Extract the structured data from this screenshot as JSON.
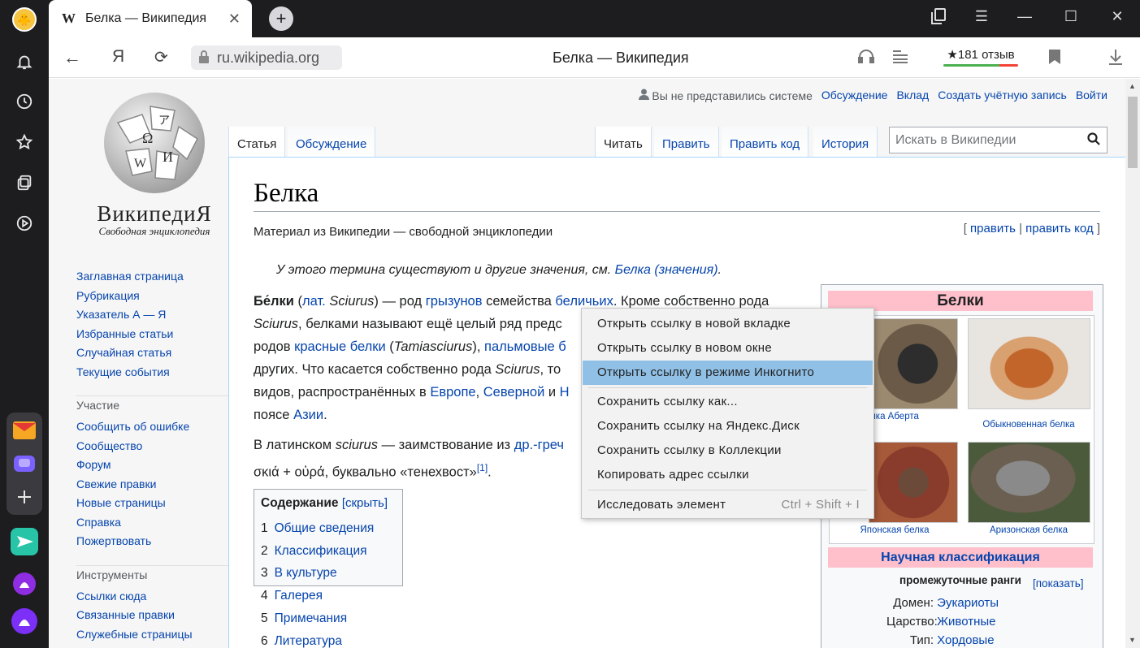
{
  "browser": {
    "tab_title": "Белка — Википедия",
    "tab_icon": "W",
    "url": "ru.wikipedia.org",
    "page_title": "Белка — Википедия",
    "reviews_label": "★181 отзыв"
  },
  "personal": {
    "not_logged": "Вы не представились системе",
    "talk": "Обсуждение",
    "contributions": "Вклад",
    "create_account": "Создать учётную запись",
    "login": "Войти"
  },
  "logo": {
    "name": "ВикипедиЯ",
    "subtitle": "Свободная энциклопедия"
  },
  "tabs": {
    "article": "Статья",
    "talk": "Обсуждение",
    "read": "Читать",
    "edit": "Править",
    "edit_source": "Править код",
    "history": "История"
  },
  "search": {
    "placeholder": "Искать в Википедии"
  },
  "sidebar": {
    "main": [
      "Заглавная страница",
      "Рубрикация",
      "Указатель А — Я",
      "Избранные статьи",
      "Случайная статья",
      "Текущие события"
    ],
    "participation_title": "Участие",
    "participation": [
      "Сообщить об ошибке",
      "Сообщество",
      "Форум",
      "Свежие правки",
      "Новые страницы",
      "Справка",
      "Пожертвовать"
    ],
    "tools_title": "Инструменты",
    "tools": [
      "Ссылки сюда",
      "Связанные правки",
      "Служебные страницы"
    ]
  },
  "article": {
    "title": "Белка",
    "tagline": "Материал из Википедии — свободной энциклопедии",
    "edit_open": "[",
    "edit": "править",
    "edit_sep": "|",
    "edit_source": "править код",
    "edit_close": "]",
    "hatnote_prefix": "У этого термина существуют и другие значения, см. ",
    "hatnote_link": "Белка (значения)",
    "hatnote_suffix": ".",
    "p1_l1_a": "Бе́лки",
    "p1_l1_b": " (",
    "p1_l1_c": "лат.",
    "p1_l1_d": " Sciurus",
    "p1_l1_e": ") — род ",
    "p1_l1_f": "грызунов",
    "p1_l1_g": " семейства ",
    "p1_l1_h": "беличьих",
    "p1_l1_i": ". Кроме собственно рода",
    "p1_l2_a": "Sciurus",
    "p1_l2_b": ", белками называют ещё целый ряд предс",
    "p1_l3_a": "родов ",
    "p1_l3_b": "красные белки",
    "p1_l3_c": " (",
    "p1_l3_d": "Tamiasciurus",
    "p1_l3_e": "), ",
    "p1_l3_f": "пальмовые б",
    "p1_l4_a": "других. Что касается собственно рода ",
    "p1_l4_b": "Sciurus",
    "p1_l4_c": ", то",
    "p1_l5_a": "видов, распространённых в ",
    "p1_l5_b": "Европе",
    "p1_l5_c": ", ",
    "p1_l5_d": "Северной",
    "p1_l5_e": " и ",
    "p1_l5_f": "Н",
    "p1_l6_a": "поясе ",
    "p1_l6_b": "Азии",
    "p1_l6_c": ".",
    "p2_l1_a": "В латинском ",
    "p2_l1_b": "sciurus",
    "p2_l1_c": " — заимствование из ",
    "p2_l1_d": "др.-греч",
    "p2_l2_a": "σκιά",
    "p2_l2_b": " + ",
    "p2_l2_c": "οὐρά",
    "p2_l2_d": ", буквально «тенехвост»",
    "p2_l2_e": "[1]",
    "p2_l2_f": "."
  },
  "toc": {
    "title": "Содержание",
    "toggle": "[скрыть]",
    "items": [
      {
        "num": "1",
        "label": "Общие сведения"
      },
      {
        "num": "2",
        "label": "Классификация"
      },
      {
        "num": "3",
        "label": "В культуре"
      },
      {
        "num": "4",
        "label": "Галерея"
      },
      {
        "num": "5",
        "label": "Примечания"
      },
      {
        "num": "6",
        "label": "Литература"
      }
    ]
  },
  "infobox": {
    "title": "Белки",
    "captions": [
      "лка Аберта",
      "Обыкновенная белка",
      "Японская белка",
      "Аризонская белка"
    ],
    "classification": "Научная классификация",
    "intermediate": "промежуточные ранги",
    "show": "[показать]",
    "rows": [
      {
        "label": "Домен:",
        "value": "Эукариоты"
      },
      {
        "label": "Царство:",
        "value": "Животные"
      },
      {
        "label": "Тип:",
        "value": "Хордовые"
      }
    ]
  },
  "context_menu": {
    "items": [
      "Открыть ссылку в новой вкладке",
      "Открыть ссылку в новом окне",
      "Открыть ссылку в режиме Инкогнито",
      "Сохранить ссылку как...",
      "Сохранить ссылку на Яндекс.Диск",
      "Сохранить ссылку в Коллекции",
      "Копировать адрес ссылки",
      "Исследовать элемент"
    ],
    "inspect_shortcut": "Ctrl + Shift + I",
    "highlighted": "Открыть ссылку в режиме Инкогнито"
  },
  "colors": {
    "link": "#0645ad",
    "infobox_header": "#ffc0cb",
    "menu_highlight": "#90c0e6",
    "browser_chrome": "#1d1d20"
  }
}
